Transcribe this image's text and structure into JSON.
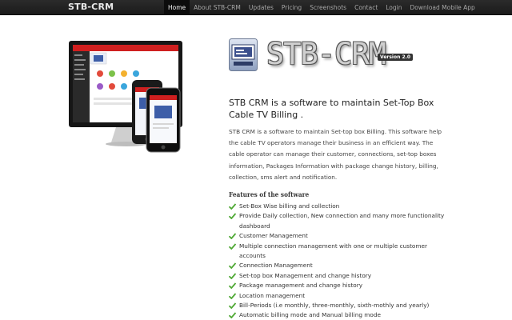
{
  "navbar": {
    "brand": "STB-CRM",
    "items": [
      {
        "label": "Home",
        "active": true
      },
      {
        "label": "About STB-CRM",
        "active": false
      },
      {
        "label": "Updates",
        "active": false
      },
      {
        "label": "Pricing",
        "active": false
      },
      {
        "label": "Screenshots",
        "active": false
      },
      {
        "label": "Contact",
        "active": false
      },
      {
        "label": "Login",
        "active": false
      },
      {
        "label": "Download Mobile App",
        "active": false
      }
    ]
  },
  "hero": {
    "logo_text": "STB-CRM",
    "version": "Version 2.0",
    "lead": "STB CRM is a software to maintain Set-Top Box Cable TV Billing .",
    "description": "STB CRM is a software to maintain Set-top box Billing. This software help the cable TV operators manage their business in an efficient way. The cable operator can manage their customer, connections, set-top boxes information, Packages Information with package change history, billing, collection, sms alert and notification."
  },
  "features": {
    "title": "Features of the software",
    "items": [
      "Set-Box Wise billing and collection",
      "Provide Daily collection, New connection and many more functionality dashboard",
      "Customer Management",
      "Multiple connection management with one or multiple customer accounts",
      "Connection Management",
      "Set-top box Management and change history",
      "Package management and change history",
      "Location management",
      "Bill-Periods (i.e monthly, three-monthly, sixth-mothly and yearly)",
      "Automatic billing mode and Manual billing mode"
    ]
  },
  "colors": {
    "navbar_bg": "#222222",
    "check_green": "#4ea833",
    "badge_bg": "#333333"
  },
  "icons": {
    "feature_bullet": "check-icon"
  }
}
